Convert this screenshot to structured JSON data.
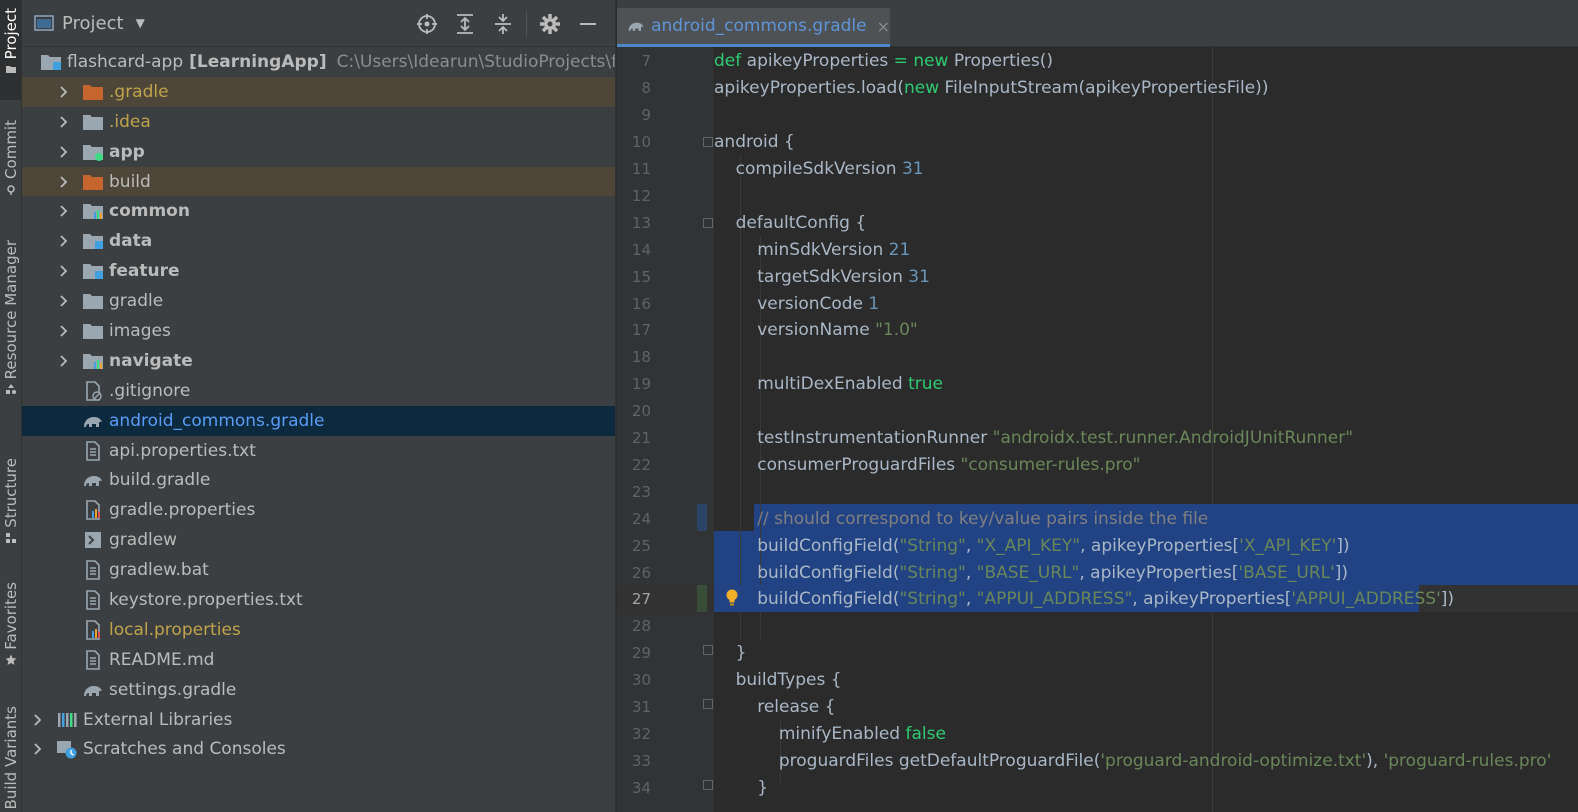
{
  "stripe": {
    "items": [
      {
        "label": "Project",
        "icon": "folder-icon"
      },
      {
        "label": "Commit",
        "icon": "commit-icon"
      },
      {
        "label": "Resource Manager",
        "icon": "resource-icon"
      },
      {
        "label": "Structure",
        "icon": "structure-icon"
      },
      {
        "label": "Favorites",
        "icon": "star-icon"
      },
      {
        "label": "Build Variants",
        "icon": "build-variants-icon"
      }
    ]
  },
  "project": {
    "title": "Project",
    "tree": [
      {
        "label": "flashcard-app",
        "module": "[LearningApp]",
        "path": "C:\\Users\\Idearun\\StudioProjects\\f",
        "indent": 0,
        "expanded": true
      },
      {
        "label": ".gradle",
        "indent": 1
      },
      {
        "label": ".idea",
        "indent": 1
      },
      {
        "label": "app",
        "indent": 1
      },
      {
        "label": "build",
        "indent": 1
      },
      {
        "label": "common",
        "indent": 1
      },
      {
        "label": "data",
        "indent": 1
      },
      {
        "label": "feature",
        "indent": 1
      },
      {
        "label": "gradle",
        "indent": 1
      },
      {
        "label": "images",
        "indent": 1
      },
      {
        "label": "navigate",
        "indent": 1
      },
      {
        "label": ".gitignore",
        "indent": 1
      },
      {
        "label": "android_commons.gradle",
        "indent": 1
      },
      {
        "label": "api.properties.txt",
        "indent": 1
      },
      {
        "label": "build.gradle",
        "indent": 1
      },
      {
        "label": "gradle.properties",
        "indent": 1
      },
      {
        "label": "gradlew",
        "indent": 1
      },
      {
        "label": "gradlew.bat",
        "indent": 1
      },
      {
        "label": "keystore.properties.txt",
        "indent": 1
      },
      {
        "label": "local.properties",
        "indent": 1
      },
      {
        "label": "README.md",
        "indent": 1
      },
      {
        "label": "settings.gradle",
        "indent": 1
      },
      {
        "label": "External Libraries",
        "indent": 0
      },
      {
        "label": "Scratches and Consoles",
        "indent": 0
      }
    ]
  },
  "editor": {
    "tab": {
      "label": "android_commons.gradle",
      "close": "×"
    },
    "lines": [
      {
        "n": "7",
        "t": [
          "kwg:def",
          " apikeyProperties ",
          "kwg:=",
          " ",
          "kwg:new",
          " Properties()"
        ]
      },
      {
        "n": "8",
        "t": [
          "apikeyProperties.load(",
          "kwg:new",
          " FileInputStream(apikeyPropertiesFile))"
        ]
      },
      {
        "n": "9",
        "t": []
      },
      {
        "n": "10",
        "t": [
          "android {"
        ]
      },
      {
        "n": "11",
        "t": [
          "    compileSdkVersion ",
          "num:31"
        ]
      },
      {
        "n": "12",
        "t": []
      },
      {
        "n": "13",
        "t": [
          "    defaultConfig {"
        ]
      },
      {
        "n": "14",
        "t": [
          "        minSdkVersion ",
          "num:21"
        ]
      },
      {
        "n": "15",
        "t": [
          "        targetSdkVersion ",
          "num:31"
        ]
      },
      {
        "n": "16",
        "t": [
          "        versionCode ",
          "num:1"
        ]
      },
      {
        "n": "17",
        "t": [
          "        versionName ",
          "str:\"1.0\""
        ]
      },
      {
        "n": "18",
        "t": []
      },
      {
        "n": "19",
        "t": [
          "        multiDexEnabled ",
          "kwg:true"
        ]
      },
      {
        "n": "20",
        "t": []
      },
      {
        "n": "21",
        "t": [
          "        testInstrumentationRunner ",
          "str:\"androidx.test.runner.AndroidJUnitRunner\""
        ]
      },
      {
        "n": "22",
        "t": [
          "        consumerProguardFiles ",
          "str:\"consumer-rules.pro\""
        ]
      },
      {
        "n": "23",
        "t": []
      },
      {
        "n": "24",
        "t": [
          "        ",
          "cmt:// should correspond to key/value pairs inside the file"
        ]
      },
      {
        "n": "25",
        "t": [
          "        buildConfigField(",
          "str:\"String\"",
          ", ",
          "str:\"X_API_KEY\"",
          ", apikeyProperties[",
          "str:'X_API_KEY'",
          "])"
        ]
      },
      {
        "n": "26",
        "t": [
          "        buildConfigField(",
          "str:\"String\"",
          ", ",
          "str:\"BASE_URL\"",
          ", apikeyProperties[",
          "str:'BASE_URL'",
          "])"
        ]
      },
      {
        "n": "27",
        "t": [
          "        buildConfigField(",
          "str:\"String\"",
          ", ",
          "str:\"APPUI_ADDRESS\"",
          ", apikeyProperties[",
          "str:'APPUI_ADDRESS'",
          "])"
        ]
      },
      {
        "n": "28",
        "t": []
      },
      {
        "n": "29",
        "t": [
          "    }"
        ]
      },
      {
        "n": "30",
        "t": [
          "    buildTypes {"
        ]
      },
      {
        "n": "31",
        "t": [
          "        release {"
        ]
      },
      {
        "n": "32",
        "t": [
          "            minifyEnabled ",
          "kwg:false"
        ]
      },
      {
        "n": "33",
        "t": [
          "            proguardFiles getDefaultProguardFile(",
          "str:'proguard-android-optimize.txt'",
          "), ",
          "str:'proguard-rules.pro'"
        ]
      },
      {
        "n": "34",
        "t": [
          "        }"
        ]
      }
    ]
  },
  "colors": {
    "accent": "#4a88c7",
    "selection": "#214283",
    "tree_selected": "#0d293e",
    "excluded": "#4e4639"
  }
}
